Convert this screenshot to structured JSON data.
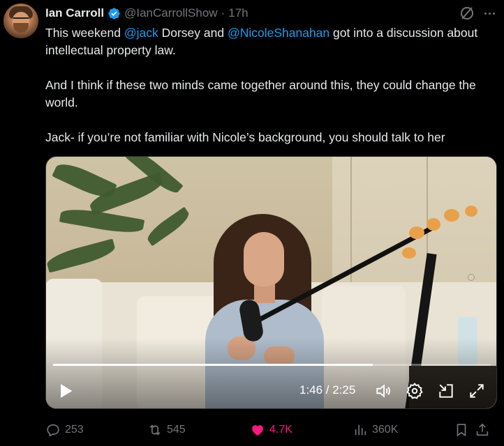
{
  "author": {
    "name": "Ian Carroll",
    "handle": "@IanCarrollShow",
    "separator": "·",
    "time": "17h"
  },
  "body": {
    "p1_pre": "This weekend ",
    "p1_mention1": "@jack",
    "p1_mid": " Dorsey and ",
    "p1_mention2": "@NicoleShanahan",
    "p1_post": " got into a discussion about intellectual property law.",
    "p2": "And I think if these two minds came together around this, they could change the world.",
    "p3": "Jack- if you’re not familiar with Nicole’s background, you should talk to her"
  },
  "video": {
    "timecode": "1:46 / 2:25",
    "progress": 0.73
  },
  "actions": {
    "replies": "253",
    "reposts": "545",
    "likes": "4.7K",
    "views": "360K"
  },
  "colors": {
    "accent": "#1d9bf0",
    "like": "#f91880",
    "muted": "#71767b",
    "text": "#e7e9ea"
  },
  "icons": [
    "grok-icon",
    "more-icon",
    "verified-badge-icon",
    "play-icon",
    "volume-icon",
    "settings-icon",
    "minimize-icon",
    "fullscreen-icon",
    "reply-icon",
    "repost-icon",
    "like-icon",
    "views-icon",
    "bookmark-icon",
    "share-icon"
  ]
}
